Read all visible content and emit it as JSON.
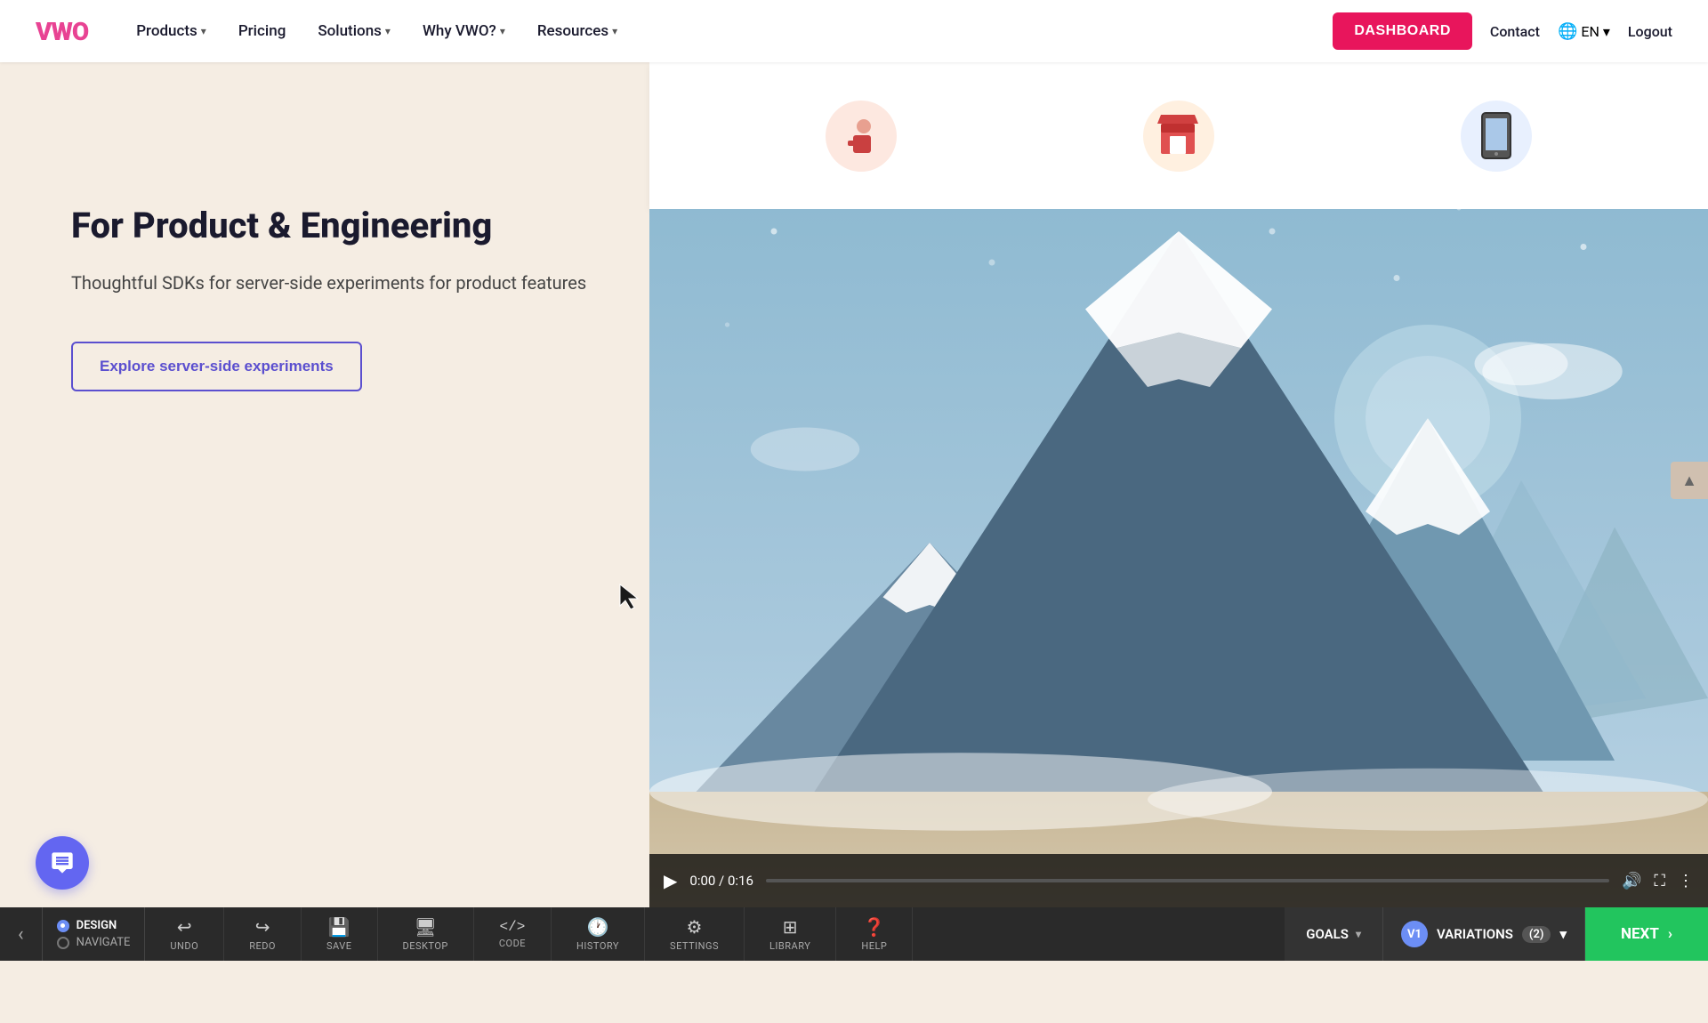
{
  "header": {
    "logo": "VWO",
    "nav": [
      {
        "label": "Products",
        "hasDropdown": true
      },
      {
        "label": "Pricing",
        "hasDropdown": false
      },
      {
        "label": "Solutions",
        "hasDropdown": true
      },
      {
        "label": "Why VWO?",
        "hasDropdown": true
      },
      {
        "label": "Resources",
        "hasDropdown": true
      }
    ],
    "dashboard_label": "DASHBOARD",
    "contact_label": "Contact",
    "lang": "EN",
    "logout_label": "Logout"
  },
  "main": {
    "section_title": "For Product & Engineering",
    "section_desc": "Thoughtful SDKs for server-side experiments for product features",
    "cta_label": "Explore server-side experiments",
    "video": {
      "time": "0:00 / 0:16"
    }
  },
  "toolbar": {
    "design_label": "DESIGN",
    "navigate_label": "NAVIGATE",
    "back_label": "<",
    "tools": [
      {
        "icon": "↩",
        "label": "UNDO"
      },
      {
        "icon": "↪",
        "label": "REDO"
      },
      {
        "icon": "💾",
        "label": "SAVE"
      },
      {
        "icon": "🖥",
        "label": "DESKTOP"
      },
      {
        "icon": "</>",
        "label": "CODE"
      },
      {
        "icon": "🕐",
        "label": "HISTORY"
      },
      {
        "icon": "⚙",
        "label": "SETTINGS"
      },
      {
        "icon": "⊞",
        "label": "LIBRARY"
      },
      {
        "icon": "?",
        "label": "HELP"
      }
    ],
    "goals_label": "GOALS",
    "variations_label": "VARIATIONS",
    "variations_count": "(2)",
    "v1_label": "V1",
    "next_label": "NEXT"
  }
}
